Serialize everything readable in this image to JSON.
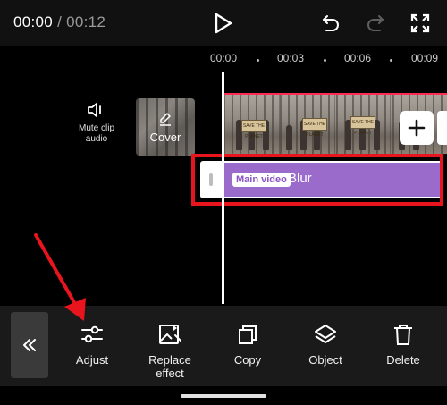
{
  "header": {
    "current_time": "00:00",
    "separator": " / ",
    "duration": "00:12"
  },
  "ruler": {
    "ticks": [
      "00:00",
      "00:03",
      "00:06",
      "00:09"
    ]
  },
  "side_tools": {
    "mute_label": "Mute clip audio",
    "cover_label": "Cover"
  },
  "video_track": {
    "signs": [
      "SAVE THE PLANET",
      "SAVE THE PLANET",
      "SAVE THE PLANET"
    ]
  },
  "effect_track": {
    "badge": "Main video",
    "name": "Blur",
    "color": "#9b6bcb"
  },
  "toolbar": {
    "items": [
      {
        "label": "Adjust",
        "icon": "sliders-icon"
      },
      {
        "label": "Replace effect",
        "icon": "image-replace-icon"
      },
      {
        "label": "Copy",
        "icon": "copy-icon"
      },
      {
        "label": "Object",
        "icon": "layers-icon"
      },
      {
        "label": "Delete",
        "icon": "trash-icon"
      }
    ]
  },
  "colors": {
    "accent_red": "#e8141e",
    "effect_purple": "#9b6bcb",
    "timeline_top_border": "#ff2d55"
  }
}
